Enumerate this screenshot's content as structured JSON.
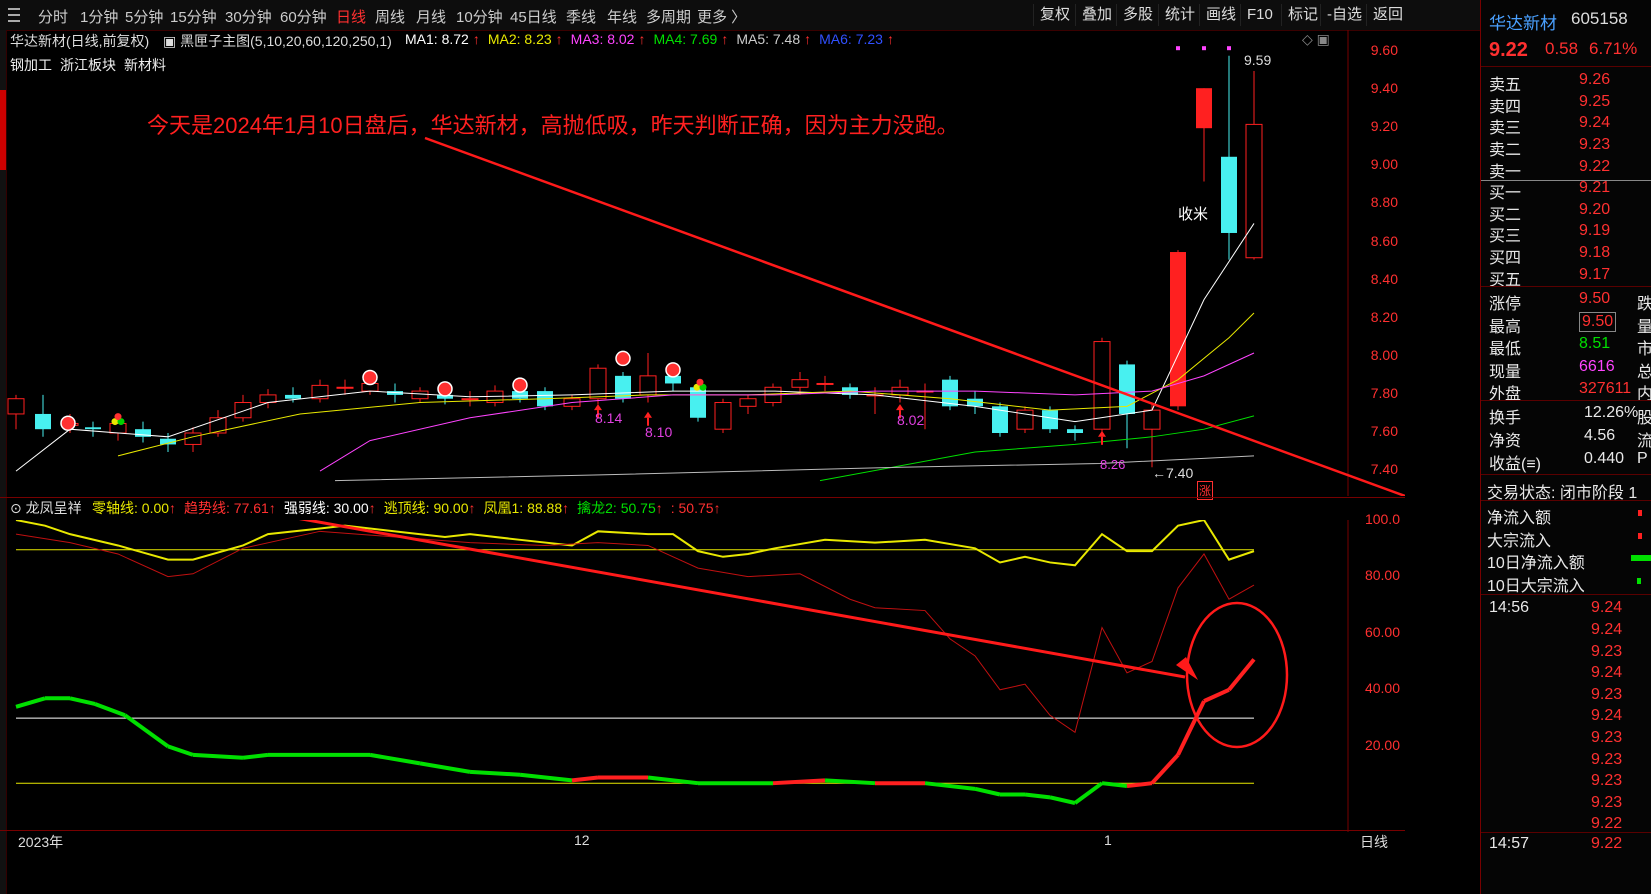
{
  "toolbar": {
    "periods": [
      "分时",
      "1分钟",
      "5分钟",
      "15分钟",
      "30分钟",
      "60分钟",
      "日线",
      "周线",
      "月线",
      "10分钟",
      "45日线",
      "季线",
      "年线",
      "多周期",
      "更多 〉"
    ],
    "active_period": "日线",
    "tools": [
      "复权",
      "叠加",
      "多股",
      "统计",
      "画线",
      "F10",
      "标记",
      "-自选",
      "返回"
    ]
  },
  "stock": {
    "name": "华达新材",
    "code": "605158",
    "price": "9.22",
    "change": "0.58",
    "pct": "6.71%"
  },
  "info_line": {
    "title": "华达新材(日线,前复权)",
    "indicator": "黑匣子主图(5,10,20,60,120,250,1)",
    "ma": [
      {
        "label": "MA1: 8.72",
        "color": "#ffffff"
      },
      {
        "label": "MA2: 8.23",
        "color": "#e8e800"
      },
      {
        "label": "MA3: 8.02",
        "color": "#ff44ff"
      },
      {
        "label": "MA4: 7.69",
        "color": "#00e000"
      },
      {
        "label": "MA5: 7.48",
        "color": "#cccccc"
      },
      {
        "label": "MA6: 7.23",
        "color": "#3050ff"
      }
    ]
  },
  "tags": [
    "钢加工",
    "浙江板块",
    "新材料"
  ],
  "annotation": "今天是2024年1月10日盘后，华达新材，高抛低吸，昨天判断正确，因为主力没跑。",
  "labels": {
    "high_price": "9.59",
    "low_price": "←7.40",
    "shoumi": "收米",
    "zhang": "涨",
    "marks": [
      "8.14",
      "8.10",
      "8.02",
      "8.26"
    ],
    "x_axis": [
      "2023年",
      "12",
      "1"
    ],
    "period_label": "日线"
  },
  "price_axis": [
    "9.60",
    "9.40",
    "9.20",
    "9.00",
    "8.80",
    "8.60",
    "8.40",
    "8.20",
    "8.00",
    "7.80",
    "7.60",
    "7.40"
  ],
  "sub_indicator": {
    "name": "龙凤呈祥",
    "items": [
      {
        "label": "零轴线: 0.00",
        "color": "#e8e800"
      },
      {
        "label": "趋势线: 77.61",
        "color": "#ff3030"
      },
      {
        "label": "强弱线: 30.00",
        "color": "#ffffff"
      },
      {
        "label": "逃顶线: 90.00",
        "color": "#e8e800"
      },
      {
        "label": "凤凰1: 88.88",
        "color": "#e8e800"
      },
      {
        "label": "擒龙2: 50.75",
        "color": "#00e000"
      },
      {
        "label": ": 50.75",
        "color": "#ff3030"
      }
    ],
    "axis": [
      "100.0",
      "80.00",
      "60.00",
      "40.00",
      "20.00"
    ]
  },
  "order_book": {
    "sell": [
      {
        "label": "卖五",
        "price": "9.26"
      },
      {
        "label": "卖四",
        "price": "9.25"
      },
      {
        "label": "卖三",
        "price": "9.24"
      },
      {
        "label": "卖二",
        "price": "9.23"
      },
      {
        "label": "卖一",
        "price": "9.22"
      }
    ],
    "buy": [
      {
        "label": "买一",
        "price": "9.21"
      },
      {
        "label": "买二",
        "price": "9.20"
      },
      {
        "label": "买三",
        "price": "9.19"
      },
      {
        "label": "买四",
        "price": "9.18"
      },
      {
        "label": "买五",
        "price": "9.17"
      }
    ]
  },
  "stats": [
    {
      "label": "涨停",
      "value": "9.50",
      "side": "跌",
      "color": "#ff3030"
    },
    {
      "label": "最高",
      "value": "9.50",
      "side": "量",
      "color": "#ff3030"
    },
    {
      "label": "最低",
      "value": "8.51",
      "side": "市",
      "color": "#00e000"
    },
    {
      "label": "现量",
      "value": "6616",
      "side": "总",
      "color": "#ff44ff"
    },
    {
      "label": "外盘",
      "value": "327611",
      "side": "内",
      "color": "#ff3030"
    }
  ],
  "stats2": [
    {
      "label": "换手",
      "value": "12.26%",
      "side": "股"
    },
    {
      "label": "净资",
      "value": "4.56",
      "side": "流"
    },
    {
      "label": "收益(≡)",
      "value": "0.440",
      "side": "P"
    }
  ],
  "trade_status": "交易状态: 闭市阶段 1",
  "flows": [
    "净流入额",
    "大宗流入",
    "10日净流入额",
    "10日大宗流入"
  ],
  "ticks": {
    "time1": "14:56",
    "prices": [
      "9.24",
      "9.24",
      "9.23",
      "9.24",
      "9.23",
      "9.24",
      "9.23",
      "9.23",
      "9.23",
      "9.23",
      "9.22"
    ],
    "time2": "14:57",
    "last": "9.22"
  }
}
